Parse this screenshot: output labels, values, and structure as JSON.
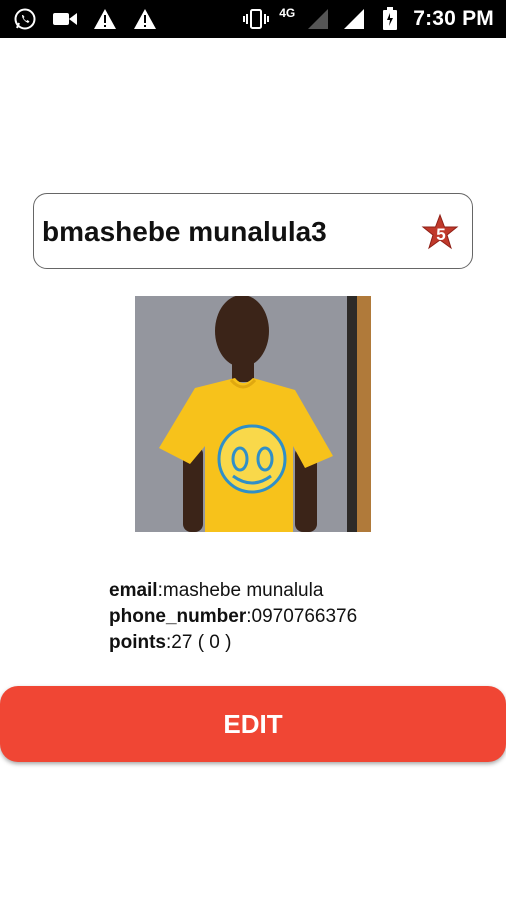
{
  "status_bar": {
    "time": "7:30 PM",
    "network": "4G",
    "icons": [
      "whatsapp-icon",
      "video-camera-icon",
      "warning-icon",
      "warning-icon",
      "vibrate-icon",
      "signal-icon",
      "signal-icon",
      "battery-icon"
    ]
  },
  "profile": {
    "username": "bmashebe munalula3",
    "rank_badge": "5",
    "email_label": "email",
    "email_value": ":mashebe munalula",
    "phone_label": "phone_number",
    "phone_value": ":0970766376",
    "points_label": "points",
    "points_value": ":27 ( 0 )"
  },
  "actions": {
    "edit_label": "EDIT"
  },
  "colors": {
    "accent": "#f04634",
    "badge": "#c0392b",
    "status_bar": "#000000"
  }
}
